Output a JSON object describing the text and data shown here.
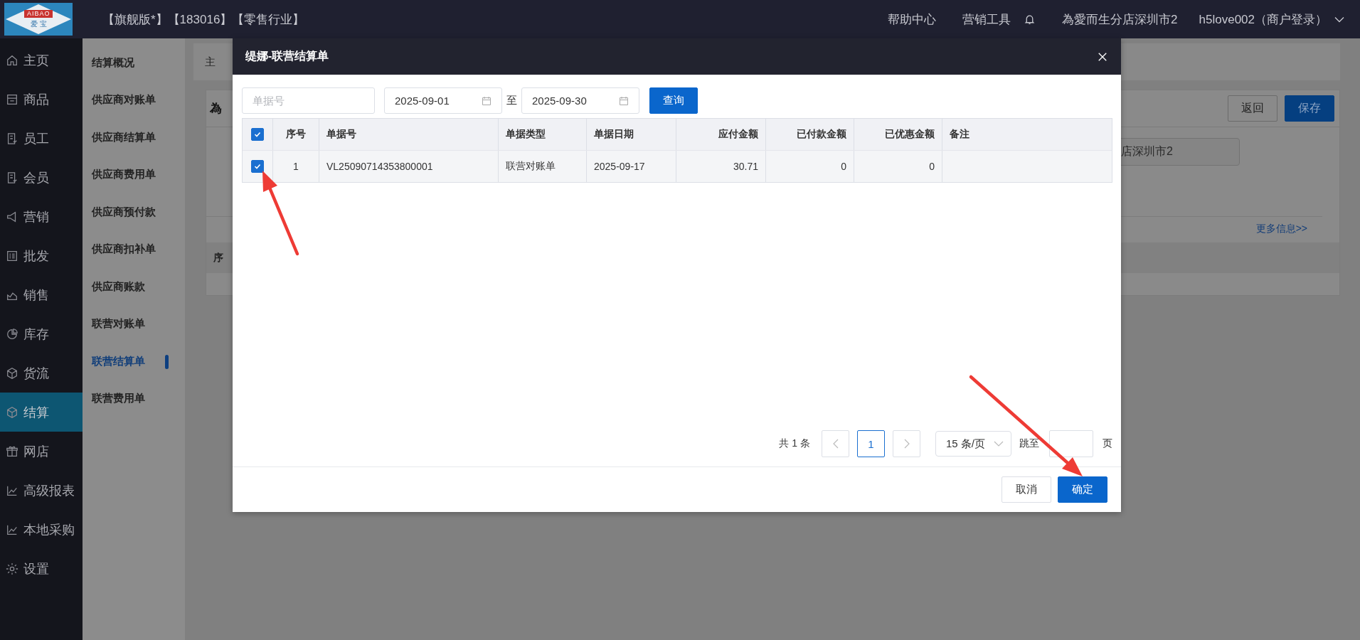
{
  "top_bar": {
    "logo_top": "AIBAO",
    "logo_bottom": "爱 宝",
    "edition": "【旗舰版*】【183016】【零售行业】",
    "links": [
      "帮助中心",
      "营销工具"
    ],
    "store": "為愛而生分店深圳市2",
    "user": "h5love002（商户登录）"
  },
  "sidebar": [
    {
      "label": "主页",
      "selected": false
    },
    {
      "label": "商品",
      "selected": false
    },
    {
      "label": "员工",
      "selected": false
    },
    {
      "label": "会员",
      "selected": false
    },
    {
      "label": "营销",
      "selected": false
    },
    {
      "label": "批发",
      "selected": false
    },
    {
      "label": "销售",
      "selected": false
    },
    {
      "label": "库存",
      "selected": false
    },
    {
      "label": "货流",
      "selected": false
    },
    {
      "label": "结算",
      "selected": true
    },
    {
      "label": "网店",
      "selected": false
    },
    {
      "label": "高级报表",
      "selected": false
    },
    {
      "label": "本地采购",
      "selected": false
    },
    {
      "label": "设置",
      "selected": false
    }
  ],
  "submenu": [
    {
      "label": "结算概况",
      "selected": false
    },
    {
      "label": "供应商对账单",
      "selected": false
    },
    {
      "label": "供应商结算单",
      "selected": false
    },
    {
      "label": "供应商费用单",
      "selected": false
    },
    {
      "label": "供应商预付款",
      "selected": false
    },
    {
      "label": "供应商扣补单",
      "selected": false
    },
    {
      "label": "供应商账款",
      "selected": false
    },
    {
      "label": "联营对账单",
      "selected": false
    },
    {
      "label": "联营结算单",
      "selected": true
    },
    {
      "label": "联营费用单",
      "selected": false
    }
  ],
  "background": {
    "breadcrumb": "主",
    "card_title": "為",
    "buttons": [
      {
        "label": "返回",
        "kind": "default"
      },
      {
        "label": "保存",
        "kind": "primary"
      }
    ],
    "store_field": "店深圳市2",
    "more_link": "更多信息>>",
    "table_header": "序"
  },
  "dialog": {
    "title": "缇娜-联营结算单",
    "filter": {
      "placeholder": "单据号",
      "date_from": "2025-09-01",
      "date_sep": "至",
      "date_to": "2025-09-30",
      "query": "查询"
    },
    "table": {
      "all_checked": true,
      "columns": [
        {
          "label": "序号",
          "kind": "index"
        },
        {
          "label": "单据号",
          "kind": "text"
        },
        {
          "label": "单据类型",
          "kind": "text"
        },
        {
          "label": "单据日期",
          "kind": "text"
        },
        {
          "label": "应付金额",
          "kind": "amount"
        },
        {
          "label": "已付款金额",
          "kind": "amount"
        },
        {
          "label": "已优惠金额",
          "kind": "amount"
        },
        {
          "label": "备注",
          "kind": "text"
        }
      ],
      "rows": [
        {
          "checked": true,
          "cells": [
            "1",
            "VL25090714353800001",
            "联营对账单",
            "2025-09-17",
            "30.71",
            "0",
            "0",
            null
          ]
        }
      ]
    },
    "pagination": {
      "total": "共 1 条",
      "pages": [
        {
          "label": "1",
          "selected": true
        }
      ],
      "page_size": "15 条/页",
      "jump_label": "跳至",
      "page_suffix": "页"
    },
    "buttons": [
      {
        "label": "取消",
        "kind": "default"
      },
      {
        "label": "确定",
        "kind": "primary"
      }
    ]
  }
}
